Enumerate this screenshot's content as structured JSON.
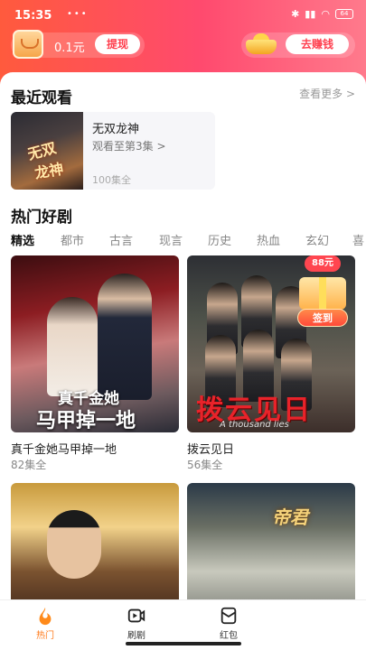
{
  "status_bar": {
    "time": "15:35",
    "icons_left": "•••",
    "battery": "64"
  },
  "header": {
    "balance": "0.1元",
    "withdraw_label": "提现",
    "earn_label": "去赚钱"
  },
  "recent": {
    "title": "最近观看",
    "see_more": "查看更多 >",
    "item": {
      "thumb_text_1": "无双",
      "thumb_text_2": "龙神",
      "name": "无双龙神",
      "progress": "观看至第3集 >",
      "episodes": "100集全"
    }
  },
  "hot": {
    "title": "热门好剧",
    "tabs": [
      "精选",
      "都市",
      "古言",
      "现言",
      "历史",
      "热血",
      "玄幻",
      "喜"
    ],
    "dramas": [
      {
        "caption_1": "真千金她",
        "caption_2": "马甲掉一地",
        "title": "真千金她马甲掉一地",
        "count": "82集全"
      },
      {
        "caption": "拨云见日",
        "english": "A thousand lies",
        "title": "拨云见日",
        "count": "56集全"
      },
      {
        "title": "",
        "count": ""
      },
      {
        "caption": "帝君",
        "title": "",
        "count": ""
      }
    ]
  },
  "promo": {
    "badge": "88元",
    "checkin": "签到"
  },
  "nav": {
    "items": [
      {
        "label": "热门",
        "icon": "flame-icon",
        "active": true
      },
      {
        "label": "刷剧",
        "icon": "video-icon",
        "active": false
      },
      {
        "label": "红包",
        "icon": "envelope-icon",
        "active": false
      }
    ]
  },
  "colors": {
    "accent": "#ff4a5a",
    "nav_active": "#ff7a1a"
  }
}
